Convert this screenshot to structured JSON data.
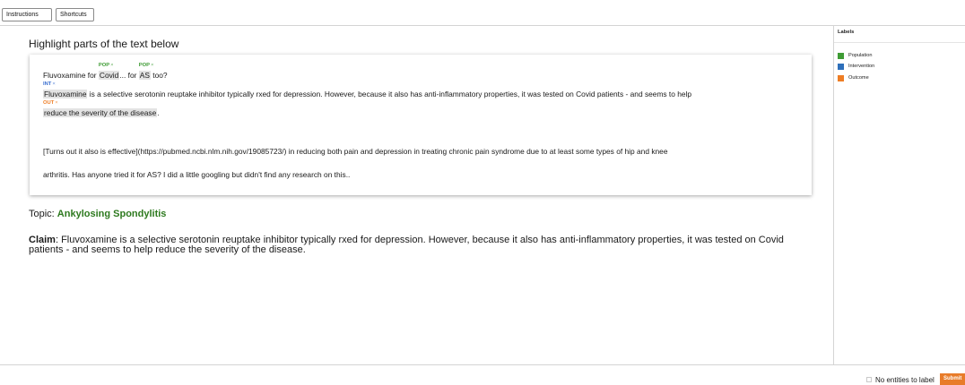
{
  "toolbar": {
    "instructions_label": "Instructions",
    "shortcuts_label": "Shortcuts"
  },
  "main": {
    "heading": "Highlight parts of the text below",
    "document": {
      "line1": {
        "pre": "Fluvoxamine for ",
        "ent1_text": "Covid",
        "ent1_tag": "POP",
        "mid": "... for ",
        "ent2_text": "AS",
        "ent2_tag": "POP",
        "post": " too?"
      },
      "line2": {
        "ent_text": "Fluvoxamine",
        "ent_tag": "INT",
        "post": " is a selective serotonin reuptake inhibitor typically rxed for depression.  However, because it also has anti-inflammatory properties, it was tested on Covid patients - and seems to help"
      },
      "line3": {
        "ent_text": "reduce the severity of the disease",
        "ent_tag": "OUT",
        "post": "."
      },
      "line4": "[Turns out it also is effective](https://pubmed.ncbi.nlm.nih.gov/19085723/) in reducing both pain and depression in treating chronic pain syndrome due to at least some types of hip and knee",
      "line5": "arthritis.  Has anyone tried it for AS?  I did a little googling but didn't find any research on this..",
      "remove_glyph": "×"
    },
    "topic_label": "Topic: ",
    "topic_value": "Ankylosing Spondylitis",
    "claim_label": "Claim",
    "claim_text": ": Fluvoxamine is a selective serotonin reuptake inhibitor typically rxed for depression. However, because it also has anti-inflammatory properties, it was tested on Covid patients - and seems to help reduce the severity of the disease."
  },
  "labels_panel": {
    "title": "Labels",
    "items": [
      {
        "label": "Population",
        "color": "#3f9c35"
      },
      {
        "label": "Intervention",
        "color": "#2e6fba"
      },
      {
        "label": "Outcome",
        "color": "#ee7d24"
      }
    ]
  },
  "footer": {
    "no_entities_label": "No entities to label",
    "submit_label": "Submit"
  }
}
